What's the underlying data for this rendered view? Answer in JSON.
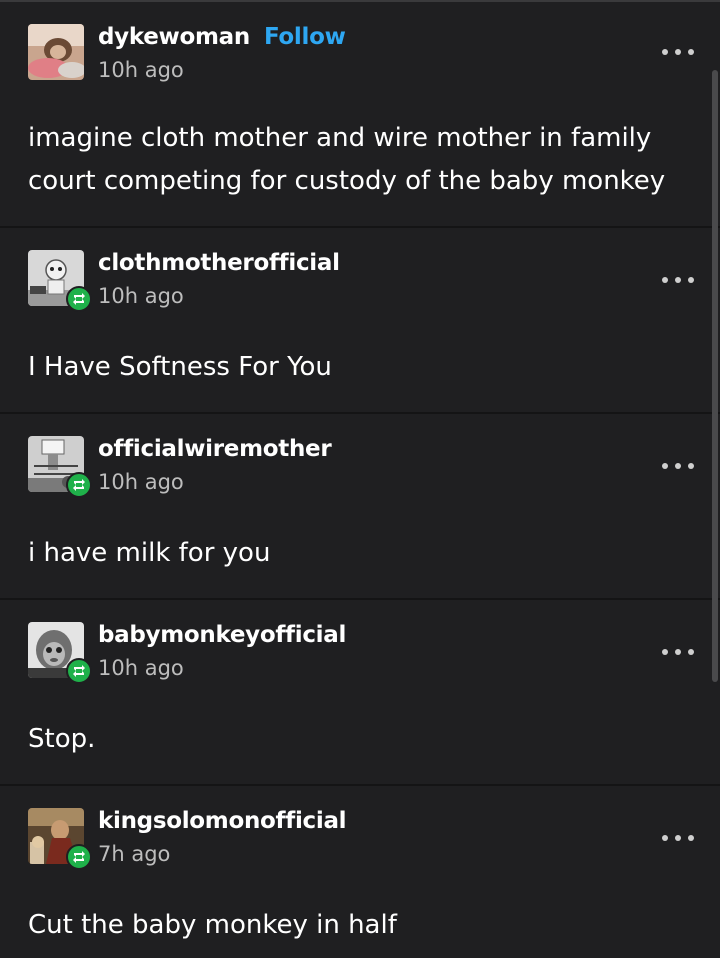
{
  "posts": [
    {
      "username": "dykewoman",
      "follow_label": "Follow",
      "time": "10h ago",
      "text": "imagine cloth mother and wire mother in family court competing for custody of the baby monkey",
      "reblog": false,
      "avatar_icon": "monkey-photo-avatar"
    },
    {
      "username": "clothmotherofficial",
      "time": "10h ago",
      "text": "I Have Softness For You",
      "reblog": true,
      "avatar_icon": "cloth-mother-photo-avatar"
    },
    {
      "username": "officialwiremother",
      "time": "10h ago",
      "text": "i have milk for you",
      "reblog": true,
      "avatar_icon": "wire-mother-photo-avatar"
    },
    {
      "username": "babymonkeyofficial",
      "time": "10h ago",
      "text": "Stop.",
      "reblog": true,
      "avatar_icon": "baby-monkey-photo-avatar"
    },
    {
      "username": "kingsolomonofficial",
      "time": "7h ago",
      "text": "Cut the baby monkey in half",
      "reblog": true,
      "avatar_icon": "king-solomon-painting-avatar"
    }
  ],
  "colors": {
    "background": "#1f1f21",
    "follow": "#2ea7f2",
    "reblog_badge": "#1fb14a",
    "time": "#bdbdbd"
  }
}
